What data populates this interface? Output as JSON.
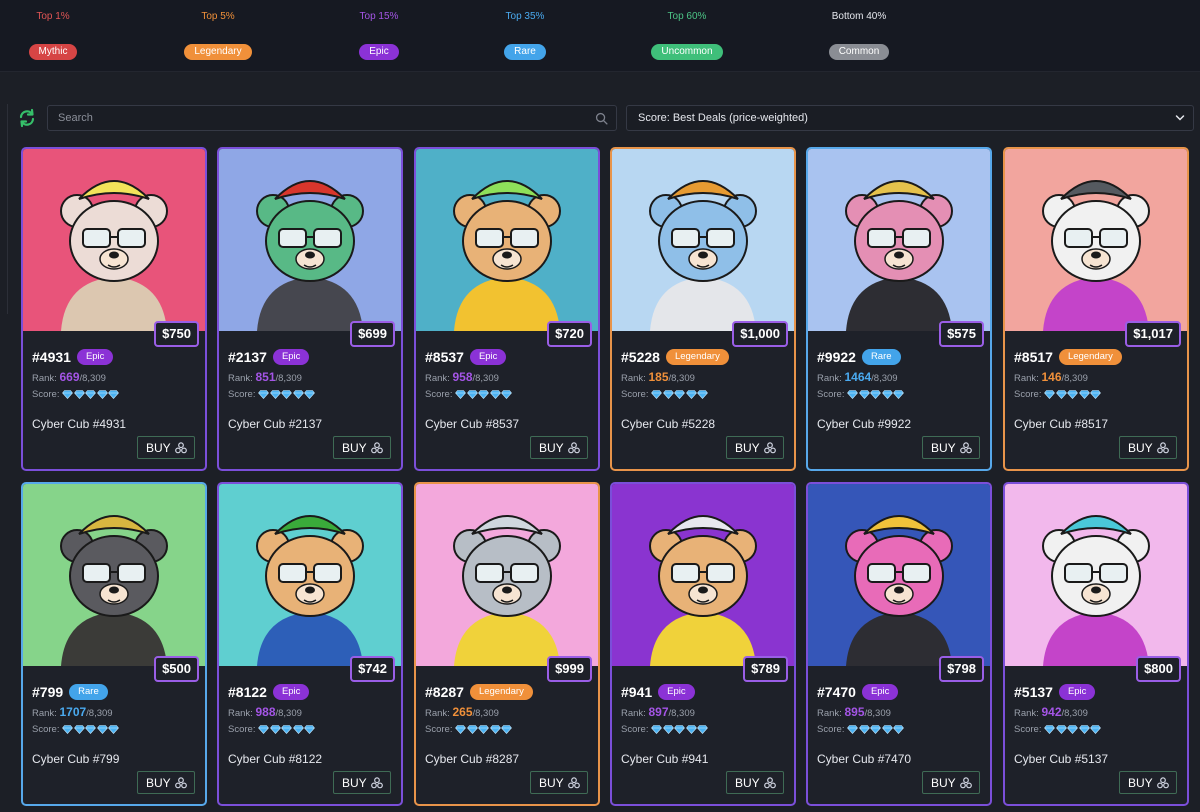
{
  "rarity_tiers": [
    {
      "label": "Top 1%",
      "badge": "Mythic",
      "color": "#d64545",
      "label_color": "#e05555"
    },
    {
      "label": "Top 5%",
      "badge": "Legendary",
      "color": "#f0903a",
      "label_color": "#f0903a"
    },
    {
      "label": "Top 15%",
      "badge": "Epic",
      "color": "#8b32d6",
      "label_color": "#a455e6"
    },
    {
      "label": "Top 35%",
      "badge": "Rare",
      "color": "#43a4ea",
      "label_color": "#4aaaf0"
    },
    {
      "label": "Top 60%",
      "badge": "Uncommon",
      "color": "#3fbf7a",
      "label_color": "#4cc586"
    },
    {
      "label": "Bottom 40%",
      "badge": "Common",
      "color": "#8a8d94",
      "label_color": "#e6e8ee"
    }
  ],
  "search": {
    "placeholder": "Search",
    "value": ""
  },
  "sort": {
    "selected": "Score: Best Deals (price-weighted)"
  },
  "rank_label": "Rank:",
  "score_label": "Score:",
  "buy_label": "BUY",
  "cards": [
    {
      "id": "#4931",
      "rarity": "Epic",
      "price": "$750",
      "rank": "669",
      "total": "/8,309",
      "name": "Cyber Cub #4931",
      "bg": "#e8547a",
      "fur": "#ecdcd6",
      "hat": "#f3e35a",
      "outfit": "#dcc7b0"
    },
    {
      "id": "#2137",
      "rarity": "Epic",
      "price": "$699",
      "rank": "851",
      "total": "/8,309",
      "name": "Cyber Cub #2137",
      "bg": "#8fa7e6",
      "fur": "#58b986",
      "hat": "#d9362c",
      "outfit": "#46474f"
    },
    {
      "id": "#8537",
      "rarity": "Epic",
      "price": "$720",
      "rank": "958",
      "total": "/8,309",
      "name": "Cyber Cub #8537",
      "bg": "#4fb0c8",
      "fur": "#e8b277",
      "hat": "#8ee05a",
      "outfit": "#f2c230"
    },
    {
      "id": "#5228",
      "rarity": "Legendary",
      "price": "$1,000",
      "rank": "185",
      "total": "/8,309",
      "name": "Cyber Cub #5228",
      "bg": "#b8d7f2",
      "fur": "#8fbfe8",
      "hat": "#e79b32",
      "outfit": "#e4e6ea"
    },
    {
      "id": "#9922",
      "rarity": "Rare",
      "price": "$575",
      "rank": "1464",
      "total": "/8,309",
      "name": "Cyber Cub #9922",
      "bg": "#a9c3f0",
      "fur": "#e48fb4",
      "hat": "#e5c24c",
      "outfit": "#2d2d33"
    },
    {
      "id": "#8517",
      "rarity": "Legendary",
      "price": "$1,017",
      "rank": "146",
      "total": "/8,309",
      "name": "Cyber Cub #8517",
      "bg": "#f2a59e",
      "fur": "#f1f1f1",
      "hat": "#555a60",
      "outfit": "#c444c9"
    },
    {
      "id": "#799",
      "rarity": "Rare",
      "price": "$500",
      "rank": "1707",
      "total": "/8,309",
      "name": "Cyber Cub #799",
      "bg": "#86d48a",
      "fur": "#5a5a5f",
      "hat": "#d7b640",
      "outfit": "#3b3b38"
    },
    {
      "id": "#8122",
      "rarity": "Epic",
      "price": "$742",
      "rank": "988",
      "total": "/8,309",
      "name": "Cyber Cub #8122",
      "bg": "#5fcfd0",
      "fur": "#e8b277",
      "hat": "#3aaa3a",
      "outfit": "#2d5fb8"
    },
    {
      "id": "#8287",
      "rarity": "Legendary",
      "price": "$999",
      "rank": "265",
      "total": "/8,309",
      "name": "Cyber Cub #8287",
      "bg": "#f3a8dc",
      "fur": "#b7bec6",
      "hat": "#cfd7de",
      "outfit": "#f0d23a"
    },
    {
      "id": "#941",
      "rarity": "Epic",
      "price": "$789",
      "rank": "897",
      "total": "/8,309",
      "name": "Cyber Cub #941",
      "bg": "#8a34d0",
      "fur": "#e8b277",
      "hat": "#e8e8ee",
      "outfit": "#f0d23a"
    },
    {
      "id": "#7470",
      "rarity": "Epic",
      "price": "$798",
      "rank": "895",
      "total": "/8,309",
      "name": "Cyber Cub #7470",
      "bg": "#3556b8",
      "fur": "#e86bb8",
      "hat": "#f0c23a",
      "outfit": "#2d2d33"
    },
    {
      "id": "#5137",
      "rarity": "Epic",
      "price": "$800",
      "rank": "942",
      "total": "/8,309",
      "name": "Cyber Cub #5137",
      "bg": "#f2b8ec",
      "fur": "#f1f1f1",
      "hat": "#4ac8d8",
      "outfit": "#c444c9"
    }
  ],
  "colors": {
    "Epic": "#8b32d6",
    "Legendary": "#f0903a",
    "Rare": "#43a4ea",
    "Epic_border": "#7b4fd9",
    "Legendary_border": "#e8944a",
    "Rare_border": "#57a8ea",
    "Epic_text": "#a455e6",
    "Legendary_text": "#f0903a",
    "Rare_text": "#4aaaf0"
  },
  "icons": {
    "refresh": "refresh-icon",
    "search": "search-icon",
    "chevron": "chevron-down-icon",
    "gem": "diamond-icon",
    "buy": "marketplace-logo-icon"
  }
}
